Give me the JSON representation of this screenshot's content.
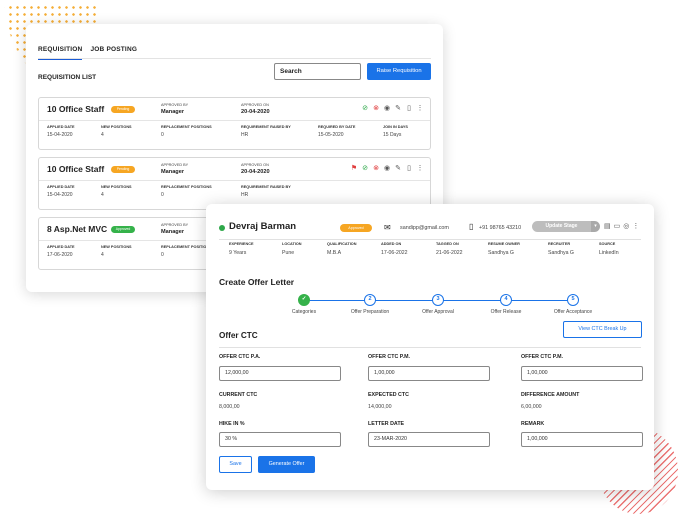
{
  "colors": {
    "accent": "#1a73e8",
    "success": "#35b24a",
    "warning": "#f6a623",
    "danger": "#e03c3c"
  },
  "requisition_panel": {
    "tabs": [
      "REQUISITION",
      "JOB POSTING"
    ],
    "active_tab": "REQUISITION",
    "list_title": "REQUISITION LIST",
    "search_placeholder": "Search",
    "raise_button": "Raise Requisition",
    "column_labels": {
      "approved_by": "APPROVED BY",
      "approved_on": "APPROVED ON",
      "applied_date": "APPLIED DATE",
      "new_positions": "NEW POSITIONS",
      "replacement_positions": "REPLACEMENT POSITIONS",
      "raised_by": "REQUIREMENT RAISED BY",
      "required_by": "REQUIRED BY DATE",
      "join_in": "JOIN IN DAYS"
    },
    "cards": [
      {
        "title": "10 Office Staff",
        "badge": "Pending",
        "badge_color": "orange",
        "approved_by": "Manager",
        "approved_on": "20-04-2020",
        "applied_date": "15-04-2020",
        "new_positions": "4",
        "replacement_positions": "0",
        "raised_by": "HR",
        "required_by": "15-05-2020",
        "join_in": "15 Days"
      },
      {
        "title": "10 Office Staff",
        "badge": "Pending",
        "badge_color": "orange",
        "approved_by": "Manager",
        "approved_on": "20-04-2020",
        "applied_date": "15-04-2020",
        "new_positions": "4",
        "replacement_positions": "0",
        "raised_by": "HR"
      },
      {
        "title": "8 Asp.Net MVC",
        "badge": "Approved",
        "badge_color": "green",
        "approved_by": "Manager",
        "applied_date": "17-06-2020",
        "new_positions": "4",
        "replacement_positions": "0"
      }
    ]
  },
  "candidate": {
    "name": "Devraj Barman",
    "status_badge": "Approved",
    "email": "sandipp@gmail.com",
    "phone": "+91 98765 43210",
    "update_stage_button": "Update Stage",
    "fields": [
      {
        "label": "EXPERIENCE",
        "value": "9 Years"
      },
      {
        "label": "LOCATION",
        "value": "Pune"
      },
      {
        "label": "QUALIFICATION",
        "value": "M.B.A"
      },
      {
        "label": "ADDED ON",
        "value": "17-06-2022"
      },
      {
        "label": "TAGGED ON",
        "value": "21-06-2022"
      },
      {
        "label": "RESUME OWNER",
        "value": "Sandhya G"
      },
      {
        "label": "RECRUITER",
        "value": "Sandhya G"
      },
      {
        "label": "SOURCE",
        "value": "LinkedIn"
      }
    ]
  },
  "offer_letter": {
    "title": "Create Offer Letter",
    "steps": [
      {
        "label": "Categories",
        "number": "",
        "done": true
      },
      {
        "label": "Offer Preparation",
        "number": "2",
        "done": false
      },
      {
        "label": "Offer Approval",
        "number": "3",
        "done": false
      },
      {
        "label": "Offer Release",
        "number": "4",
        "done": false
      },
      {
        "label": "Offer Acceptance",
        "number": "5",
        "done": false
      }
    ],
    "ctc_breakup_button": "View CTC Break Up",
    "ctc_title": "Offer CTC",
    "offer_ctc_pa_label": "OFFER CTC P.A.",
    "offer_ctc_pa_value": "12,000,00",
    "offer_ctc_pm_label": "OFFER CTC P.M.",
    "offer_ctc_pm_value": "1,00,000",
    "offer_ctc_pm2_label": "OFFER CTC P.M.",
    "offer_ctc_pm2_value": "1,00,000",
    "current_ctc_label": "CURRENT CTC",
    "current_ctc_value": "8,000,00",
    "expected_ctc_label": "EXPECTED CTC",
    "expected_ctc_value": "14,000,00",
    "difference_label": "DIFFERENCE AMOUNT",
    "difference_value": "6,00,000",
    "hike_label": "HIKE IN %",
    "hike_value": "30 %",
    "letter_date_label": "LETTER DATE",
    "letter_date_value": "23-MAR-2020",
    "remark_label": "REMARK",
    "remark_value": "1,00,000",
    "save_button": "Save",
    "generate_button": "Generate Offer"
  }
}
